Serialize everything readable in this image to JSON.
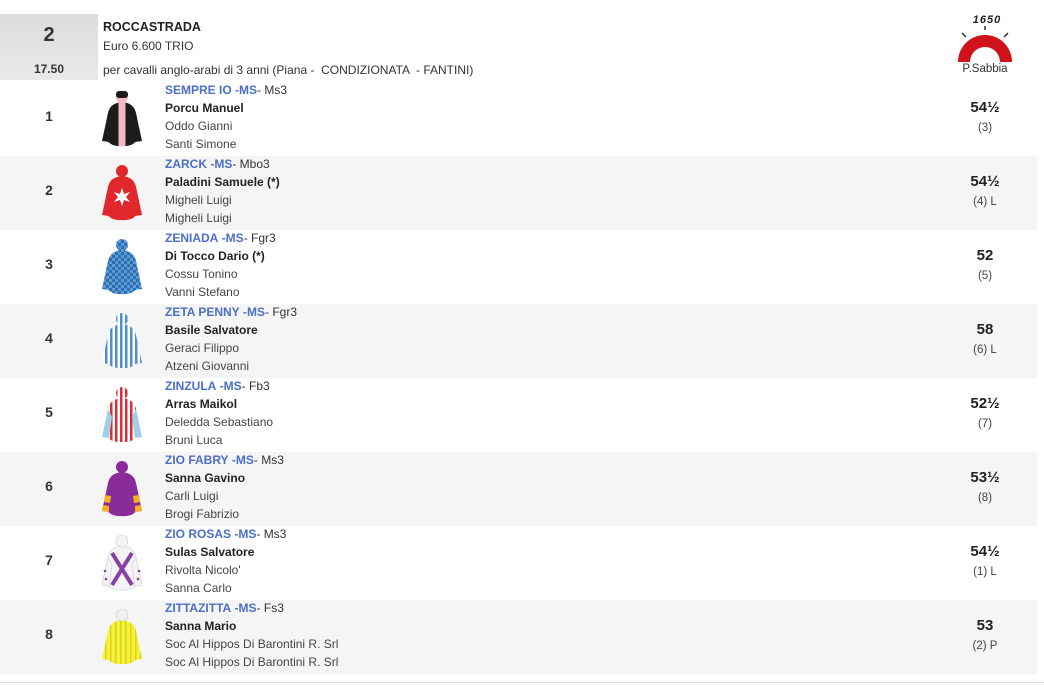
{
  "race": {
    "number": "2",
    "time": "17.50",
    "name": "ROCCASTRADA",
    "prize": "Euro 6.600 TRIO",
    "description": "per cavalli anglo-arabi di 3 anni (Piana -  CONDIZIONATA  - FANTINI)",
    "distance": "1650",
    "track": "P.Sabbia"
  },
  "colors": {
    "horse_link": "#4a6fc7",
    "alt_row": "#f5f5f5",
    "track_red": "#d0121b"
  },
  "runners": [
    {
      "pos": "1",
      "horse": "SEMPRE IO",
      "tag": "-MS",
      "code": "- Ms3",
      "jockey": "Porcu Manuel",
      "trainer": "Oddo Gianni",
      "owner": "Santi Simone",
      "weight": "54½",
      "draw": "(3)"
    },
    {
      "pos": "2",
      "horse": "ZARCK",
      "tag": "-MS",
      "code": "- Mbo3",
      "jockey": "Paladini Samuele (*)",
      "trainer": "Migheli Luigi",
      "owner": "Migheli Luigi",
      "weight": "54½",
      "draw": "(4) L"
    },
    {
      "pos": "3",
      "horse": "ZENIADA",
      "tag": "-MS",
      "code": "- Fgr3",
      "jockey": "Di Tocco Dario (*)",
      "trainer": "Cossu Tonino",
      "owner": "Vanni Stefano",
      "weight": "52",
      "draw": "(5)"
    },
    {
      "pos": "4",
      "horse": "ZETA PENNY",
      "tag": "-MS",
      "code": "- Fgr3",
      "jockey": "Basile Salvatore",
      "trainer": "Geraci Filippo",
      "owner": "Atzeni Giovanni",
      "weight": "58",
      "draw": "(6) L"
    },
    {
      "pos": "5",
      "horse": "ZINZULA",
      "tag": "-MS",
      "code": "- Fb3",
      "jockey": "Arras Maikol",
      "trainer": "Deledda Sebastiano",
      "owner": "Bruni Luca",
      "weight": "52½",
      "draw": "(7)"
    },
    {
      "pos": "6",
      "horse": "ZIO FABRY",
      "tag": "-MS",
      "code": "- Ms3",
      "jockey": "Sanna Gavino",
      "trainer": "Carli Luigi",
      "owner": "Brogi Fabrizio",
      "weight": "53½",
      "draw": "(8)"
    },
    {
      "pos": "7",
      "horse": "ZIO ROSAS",
      "tag": "-MS",
      "code": "- Ms3",
      "jockey": "Sulas Salvatore",
      "trainer": "Rivolta Nicolo'",
      "owner": "Sanna Carlo",
      "weight": "54½",
      "draw": "(1) L"
    },
    {
      "pos": "8",
      "horse": "ZITTAZITTA",
      "tag": "-MS",
      "code": "- Fs3",
      "jockey": "Sanna Mario",
      "trainer": "Soc Al Hippos Di Barontini R. Srl",
      "owner": "Soc Al Hippos Di Barontini R. Srl",
      "weight": "53",
      "draw": "(2) P"
    }
  ]
}
